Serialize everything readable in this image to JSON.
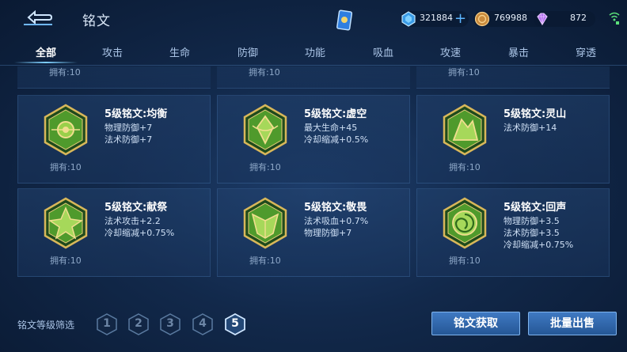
{
  "header": {
    "title": "铭文",
    "currencies": [
      {
        "name": "diamond",
        "icon": "blue-gem-icon",
        "value": "321884"
      },
      {
        "name": "gold",
        "icon": "gold-coin-icon",
        "value": "769988"
      },
      {
        "name": "crystal",
        "icon": "purple-crystal-icon",
        "value": "872"
      }
    ]
  },
  "tabs": [
    {
      "label": "全部",
      "active": true
    },
    {
      "label": "攻击",
      "active": false
    },
    {
      "label": "生命",
      "active": false
    },
    {
      "label": "防御",
      "active": false
    },
    {
      "label": "功能",
      "active": false
    },
    {
      "label": "吸血",
      "active": false
    },
    {
      "label": "攻速",
      "active": false
    },
    {
      "label": "暴击",
      "active": false
    },
    {
      "label": "穿透",
      "active": false
    }
  ],
  "partial_row": [
    {
      "owned": "拥有:10"
    },
    {
      "owned": "拥有:10"
    },
    {
      "owned": "拥有:10"
    }
  ],
  "runes": [
    {
      "name": "5级铭文:均衡",
      "stats": [
        "物理防御+7",
        "法术防御+7"
      ],
      "owned": "拥有:10",
      "icon": "balance-rune-icon"
    },
    {
      "name": "5级铭文:虚空",
      "stats": [
        "最大生命+45",
        "冷却缩减+0.5%"
      ],
      "owned": "拥有:10",
      "icon": "void-rune-icon"
    },
    {
      "name": "5级铭文:灵山",
      "stats": [
        "法术防御+14"
      ],
      "owned": "拥有:10",
      "icon": "spirit-mountain-rune-icon"
    },
    {
      "name": "5级铭文:献祭",
      "stats": [
        "法术攻击+2.2",
        "冷却缩减+0.75%"
      ],
      "owned": "拥有:10",
      "icon": "sacrifice-rune-icon"
    },
    {
      "name": "5级铭文:敬畏",
      "stats": [
        "法术吸血+0.7%",
        "物理防御+7"
      ],
      "owned": "拥有:10",
      "icon": "awe-rune-icon"
    },
    {
      "name": "5级铭文:回声",
      "stats": [
        "物理防御+3.5",
        "法术防御+3.5",
        "冷却缩减+0.75%"
      ],
      "owned": "拥有:10",
      "icon": "echo-rune-icon"
    }
  ],
  "footer": {
    "filter_label": "铭文等级筛选",
    "levels": [
      "1",
      "2",
      "3",
      "4",
      "5"
    ],
    "active_level": "5",
    "obtain_label": "铭文获取",
    "bulk_sell_label": "批量出售"
  }
}
